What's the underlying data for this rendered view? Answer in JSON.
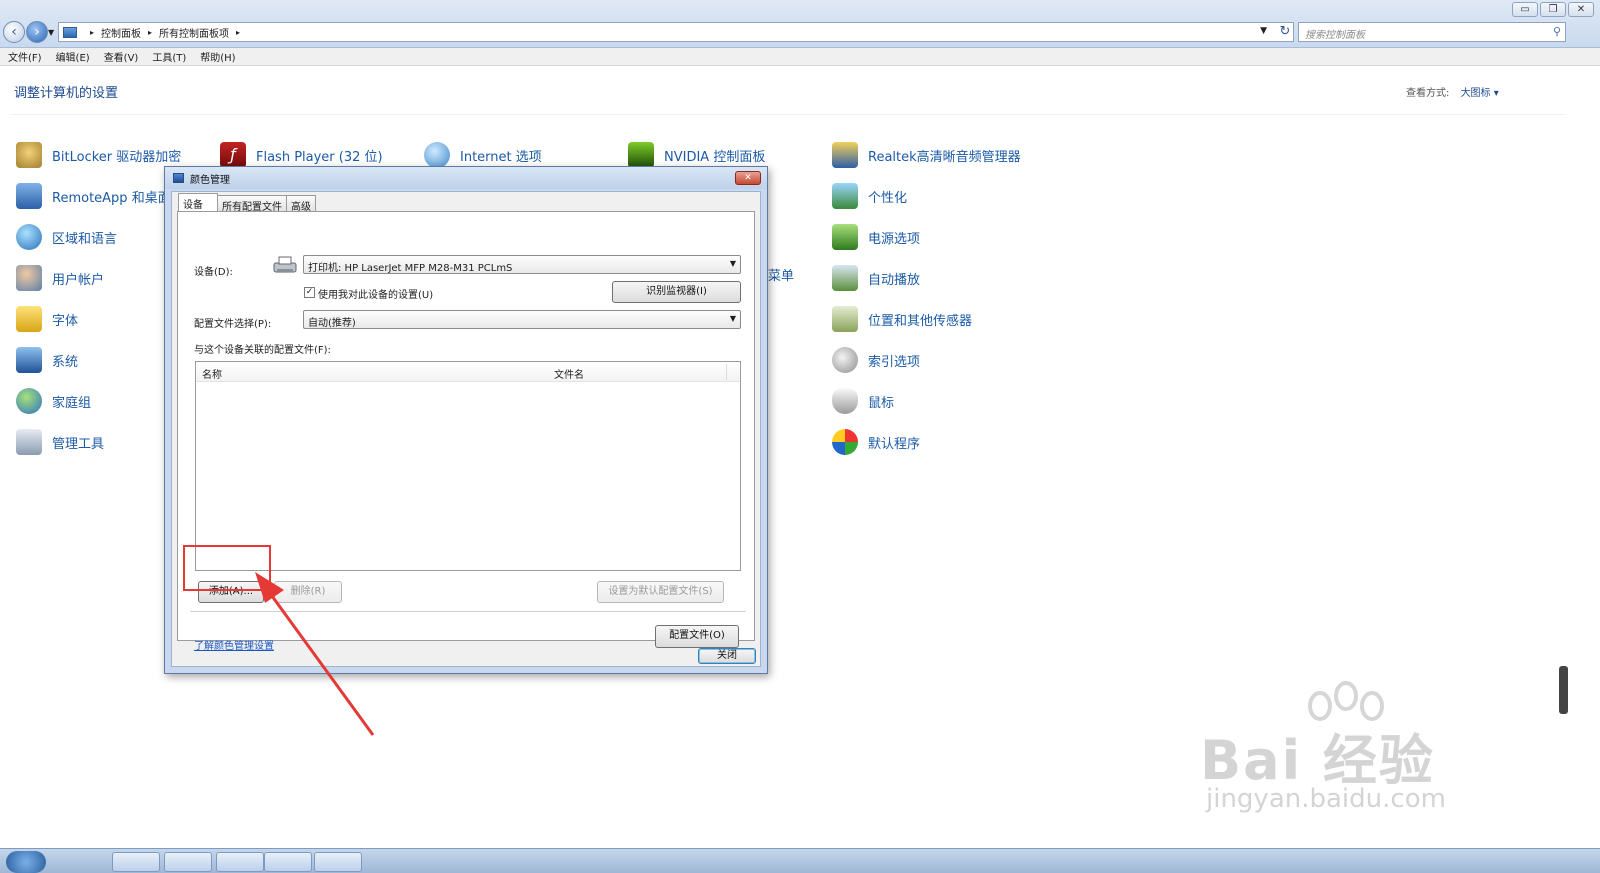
{
  "window": {
    "buttons": [
      "minimize",
      "maximize",
      "close"
    ]
  },
  "address": {
    "crumbs": [
      "控制面板",
      "所有控制面板项"
    ],
    "search_placeholder": "搜索控制面板"
  },
  "menu": [
    "文件(F)",
    "编辑(E)",
    "查看(V)",
    "工具(T)",
    "帮助(H)"
  ],
  "main": {
    "title": "调整计算机的设置",
    "view_by_label": "查看方式:",
    "view_by_value": "大图标 ▾"
  },
  "items": {
    "col1": [
      "BitLocker 驱动器加密",
      "RemoteApp 和桌面",
      "区域和语言",
      "用户帐户",
      "字体",
      "系统",
      "家庭组",
      "管理工具"
    ],
    "top_row": [
      "Flash Player (32 位)",
      "Internet 选项",
      "NVIDIA 控制面板"
    ],
    "col5": [
      "Realtek高清晰音频管理器",
      "个性化",
      "电源选项",
      "自动播放",
      "位置和其他传感器",
      "索引选项",
      "鼠标",
      "默认程序"
    ],
    "partial": "菜单"
  },
  "dialog": {
    "title": "颜色管理",
    "tabs": [
      "设备",
      "所有配置文件",
      "高级"
    ],
    "device_label": "设备(D):",
    "device_value": "打印机: HP LaserJet MFP M28-M31 PCLmS",
    "use_settings_checkbox": "使用我对此设备的设置(U)",
    "use_settings_checked": true,
    "identify_monitors_button": "识别监视器(I)",
    "profile_selection_label": "配置文件选择(P):",
    "profile_selection_value": "自动(推荐)",
    "associated_profiles_label": "与这个设备关联的配置文件(F):",
    "columns": [
      "名称",
      "文件名"
    ],
    "add_button": "添加(A)...",
    "remove_button": "删除(R)",
    "set_default_button": "设置为默认配置文件(S)",
    "learn_link": "了解颜色管理设置",
    "profiles_button": "配置文件(O)",
    "close_button": "关闭"
  },
  "watermark": {
    "brand": "Bai  经验",
    "url": "jingyan.baidu.com"
  }
}
